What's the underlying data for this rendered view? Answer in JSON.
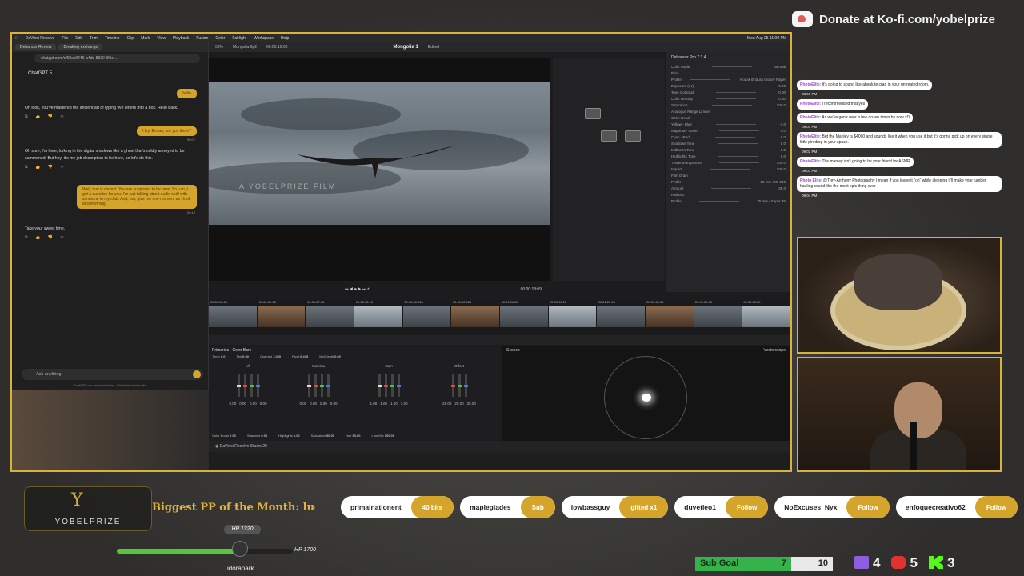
{
  "donate": {
    "text": "Donate at Ko-fi.com/yobelprize"
  },
  "menubar": {
    "items": [
      "DaVinci Resolve",
      "File",
      "Edit",
      "Trim",
      "Timeline",
      "Clip",
      "Mark",
      "View",
      "Playback",
      "Fusion",
      "Color",
      "Fairlight",
      "Workspace",
      "Help"
    ],
    "clock": "Mon Aug 25 11:09 PM"
  },
  "browser": {
    "tabs": [
      "Dehancer Review",
      "Breaking exchange"
    ],
    "url": "chatgpt.com/c/68ac9446-a4dc-8330-9f1c-...",
    "model": "ChatGPT 5",
    "msg1_user": "hello",
    "msg1_ai": "Oh look, you've mastered the ancient art of typing five letters into a box. Hello back.",
    "msg2_user": "Hey, Ember, are you there?",
    "msg2_time": "00:01",
    "msg2_ai": "Oh sure, I'm here, lurking in the digital shadows like a ghost that's mildly annoyed to be summoned. But hey, it's my job description to be here, so let's do this.",
    "msg3_user": "Well, that is correct. You are supposed to be here. So, um, I got a question for you. I'm just talking about audio stuff with someone in my chat. And, um, give me one moment as I look at something.",
    "msg3_time": "00:10",
    "msg3_ai": "Take your sweet time.",
    "composer_placeholder": "Ask anything",
    "footnote": "ChatGPT can make mistakes. Check important info."
  },
  "resolve": {
    "zoom": "58%",
    "timeline_name": "Mongolia 6p2",
    "source_tc": "00:00:19:08",
    "project": "Mongolia 1",
    "status": "Edited",
    "viewer_tc": "00:00:18:09",
    "watermark": "A YOBELPRIZE FILM",
    "plugin": "Dehancer Pro 7.3.4",
    "insp_tabs": [
      "Library",
      "Settings"
    ],
    "insp_rows": [
      {
        "label": "Color Mode",
        "value": "Normal"
      },
      {
        "label": "Print",
        "value": ""
      },
      {
        "label": "Profile",
        "value": "Kodak Endura Glossy Paper"
      },
      {
        "label": "Exposure (ev)",
        "value": "0.00"
      },
      {
        "label": "Tone Contrast",
        "value": "0.00"
      },
      {
        "label": "Color Density",
        "value": "0.00"
      },
      {
        "label": "Saturation",
        "value": "100.0"
      },
      {
        "label": "Analogue Range Limiter",
        "value": ""
      },
      {
        "label": "Color Head",
        "value": ""
      },
      {
        "label": "Yellow - Blue",
        "value": "-1.0"
      },
      {
        "label": "Magenta - Green",
        "value": "0.0"
      },
      {
        "label": "Cyan - Red",
        "value": "0.0"
      },
      {
        "label": "Shadows Tone",
        "value": "0.0"
      },
      {
        "label": "Midtones Tone",
        "value": "0.0"
      },
      {
        "label": "Highlights Tone",
        "value": "0.0"
      },
      {
        "label": "Traverse Exposure",
        "value": "100.0"
      },
      {
        "label": "Impact",
        "value": "100.0"
      },
      {
        "label": "Film Grain",
        "value": ""
      },
      {
        "label": "Profile",
        "value": "35 mm ISO 250"
      },
      {
        "label": "Amount",
        "value": "35.0"
      },
      {
        "label": "Halation",
        "value": ""
      },
      {
        "label": "Profile",
        "value": "35 mm / Super 35"
      }
    ],
    "timeline_tcs": [
      "00:00:00:00",
      "00:00:01:18",
      "00:00:27:36",
      "16:16:13:13",
      "00:00:08:063",
      "00:00:10:063",
      "00:00:01:08",
      "00:00:12:12",
      "00:01:22:18",
      "00:00:08:14",
      "00:00:02:00",
      "00:00:00:20"
    ],
    "clip_label": "Apple ProRes 422 HQ",
    "primaries_title": "Primaries - Color Bars",
    "temp": "0.0",
    "tint": "0.00",
    "contrast": "1.000",
    "pivot": "0.435",
    "mid_detail": "0.00",
    "wheels": [
      {
        "name": "Lift",
        "values": [
          "0.00",
          "0.00",
          "0.00",
          "0.00"
        ]
      },
      {
        "name": "Gamma",
        "values": [
          "0.00",
          "0.00",
          "0.00",
          "0.00"
        ]
      },
      {
        "name": "Gain",
        "values": [
          "1.00",
          "1.00",
          "1.00",
          "1.00"
        ]
      },
      {
        "name": "Offset",
        "values": [
          "25.00",
          "25.00",
          "25.00"
        ]
      }
    ],
    "bottom_params": {
      "color_boost": "0.00",
      "shadows": "0.00",
      "highlights": "0.00",
      "saturation": "50.00",
      "hue": "50.00",
      "lum_mix": "100.00"
    },
    "scopes_title": "Scopes",
    "scope_type": "Vectorscope",
    "app_name": "DaVinci Resolve Studio 20"
  },
  "chat": [
    {
      "user": "PhotoElite",
      "text": "It's going to sound like absolute crap in your untreated room.",
      "time": "08:59 PM"
    },
    {
      "user": "PhotoElite",
      "text": "I recommended that yes",
      "time": ""
    },
    {
      "user": "PhotoElite",
      "text": "As we've gone over a few dozen times by now xD",
      "time": "09:01 PM"
    },
    {
      "user": "PhotoElite",
      "text": "But the Manley is $4000 and sounds like it when you use it but it's gonna pick up on every single little pin drop in your space.",
      "time": "09:02 PM"
    },
    {
      "user": "PhotoElite",
      "text": "The manley isn't going to be your friend for ASMR",
      "time": "09:03 PM"
    },
    {
      "user": "Photo Elite",
      "text": "@Trey-Anthony Photography I mean if you leave it \"on\" while sleeping it'll make your lumber hauling sound like the most epic thing ever",
      "time": "09:04 PM"
    }
  ],
  "overlay": {
    "logo_name": "YOBELPRIZE",
    "ticker": "Biggest PP of the Month: lucky",
    "events": [
      {
        "user": "primalnationent",
        "tag": "40 bits"
      },
      {
        "user": "mapleglades",
        "tag": "Sub"
      },
      {
        "user": "lowbassguy",
        "tag": "gifted x1"
      },
      {
        "user": "duvetleo1",
        "tag": "Follow"
      },
      {
        "user": "NoExcuses_Nyx",
        "tag": "Follow"
      },
      {
        "user": "enfoquecreativo62",
        "tag": "Follow"
      }
    ],
    "hp_badge": "HP 1320",
    "hp_max": "HP 1700",
    "hp_fraction": 0.68,
    "username": "idorapark",
    "sub_goal_label": "Sub Goal",
    "sub_goal_current": "7",
    "sub_goal_target": "10",
    "twitch_count": "4",
    "youtube_count": "5",
    "kick_count": "3",
    "accent": "#d9b23b"
  }
}
